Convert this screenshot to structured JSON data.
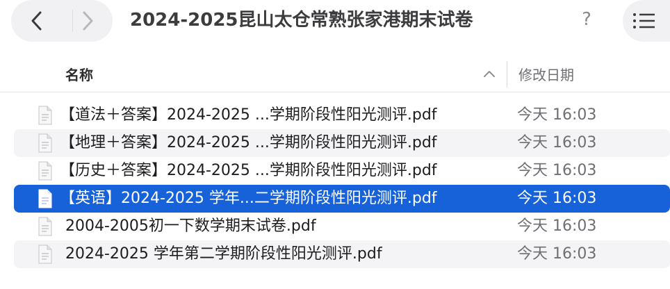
{
  "toolbar": {
    "title": "2024-2025昆山太仓常熟张家港期末试卷",
    "help_label": "?",
    "back_icon": "chevron-left-icon",
    "forward_icon": "chevron-right-icon",
    "view_icon": "list-view-icon"
  },
  "columns": {
    "name": "名称",
    "date": "修改日期",
    "sort": "ascending"
  },
  "files": [
    {
      "name": "【道法＋答案】2024-2025 ...学期阶段性阳光测评.pdf",
      "date": "今天 16:03",
      "selected": false
    },
    {
      "name": "【地理＋答案】2024-2025 ...学期阶段性阳光测评.pdf",
      "date": "今天 16:03",
      "selected": false
    },
    {
      "name": "【历史＋答案】2024-2025 ...学期阶段性阳光测评.pdf",
      "date": "今天 16:03",
      "selected": false
    },
    {
      "name": "【英语】2024-2025 学年...二学期阶段性阳光测评.pdf",
      "date": "今天 16:03",
      "selected": true
    },
    {
      "name": "2004-2005初一下数学期末试卷.pdf",
      "date": "今天 16:03",
      "selected": false
    },
    {
      "name": "2024-2025 学年第二学期阶段性阳光测评.pdf",
      "date": "今天 16:03",
      "selected": false
    }
  ],
  "colors": {
    "selection": "#1762d8",
    "alt_row": "#f4f4f6"
  }
}
